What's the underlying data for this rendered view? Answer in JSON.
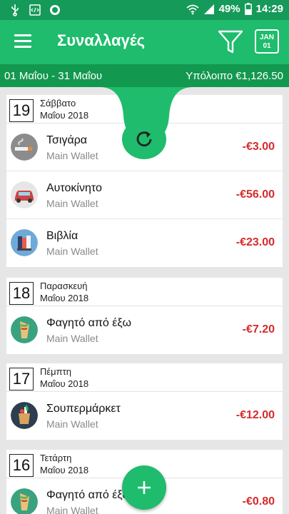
{
  "status": {
    "battery": "49%",
    "time": "14:29"
  },
  "appbar": {
    "title": "Συναλλαγές",
    "calendar_month": "JAN",
    "calendar_day": "01"
  },
  "range": {
    "dates": "01 Μαΐου - 31 Μαΐου",
    "balance": "Υπόλοιπο €1,126.50"
  },
  "days": [
    {
      "num": "19",
      "name": "Σάββατο",
      "month": "Μαΐου 2018",
      "tx": [
        {
          "cat": "Τσιγάρα",
          "wallet": "Main Wallet",
          "amount": "-€3.00",
          "icon": "cigarette-icon"
        },
        {
          "cat": "Αυτοκίνητο",
          "wallet": "Main Wallet",
          "amount": "-€56.00",
          "icon": "car-icon"
        },
        {
          "cat": "Βιβλία",
          "wallet": "Main Wallet",
          "amount": "-€23.00",
          "icon": "books-icon"
        }
      ]
    },
    {
      "num": "18",
      "name": "Παρασκευή",
      "month": "Μαΐου 2018",
      "tx": [
        {
          "cat": "Φαγητό από έξω",
          "wallet": "Main Wallet",
          "amount": "-€7.20",
          "icon": "burrito-icon"
        }
      ]
    },
    {
      "num": "17",
      "name": "Πέμπτη",
      "month": "Μαΐου 2018",
      "tx": [
        {
          "cat": "Σουπερμάρκετ",
          "wallet": "Main Wallet",
          "amount": "-€12.00",
          "icon": "grocery-bag-icon"
        }
      ]
    },
    {
      "num": "16",
      "name": "Τετάρτη",
      "month": "Μαΐου 2018",
      "tx": [
        {
          "cat": "Φαγητό από έξω",
          "wallet": "Main Wallet",
          "amount": "-€0.80",
          "icon": "burrito-icon"
        }
      ]
    }
  ],
  "colors": {
    "primary": "#1ebc6c",
    "status": "#159a59",
    "range": "#13984f",
    "expense": "#d62b2b"
  }
}
